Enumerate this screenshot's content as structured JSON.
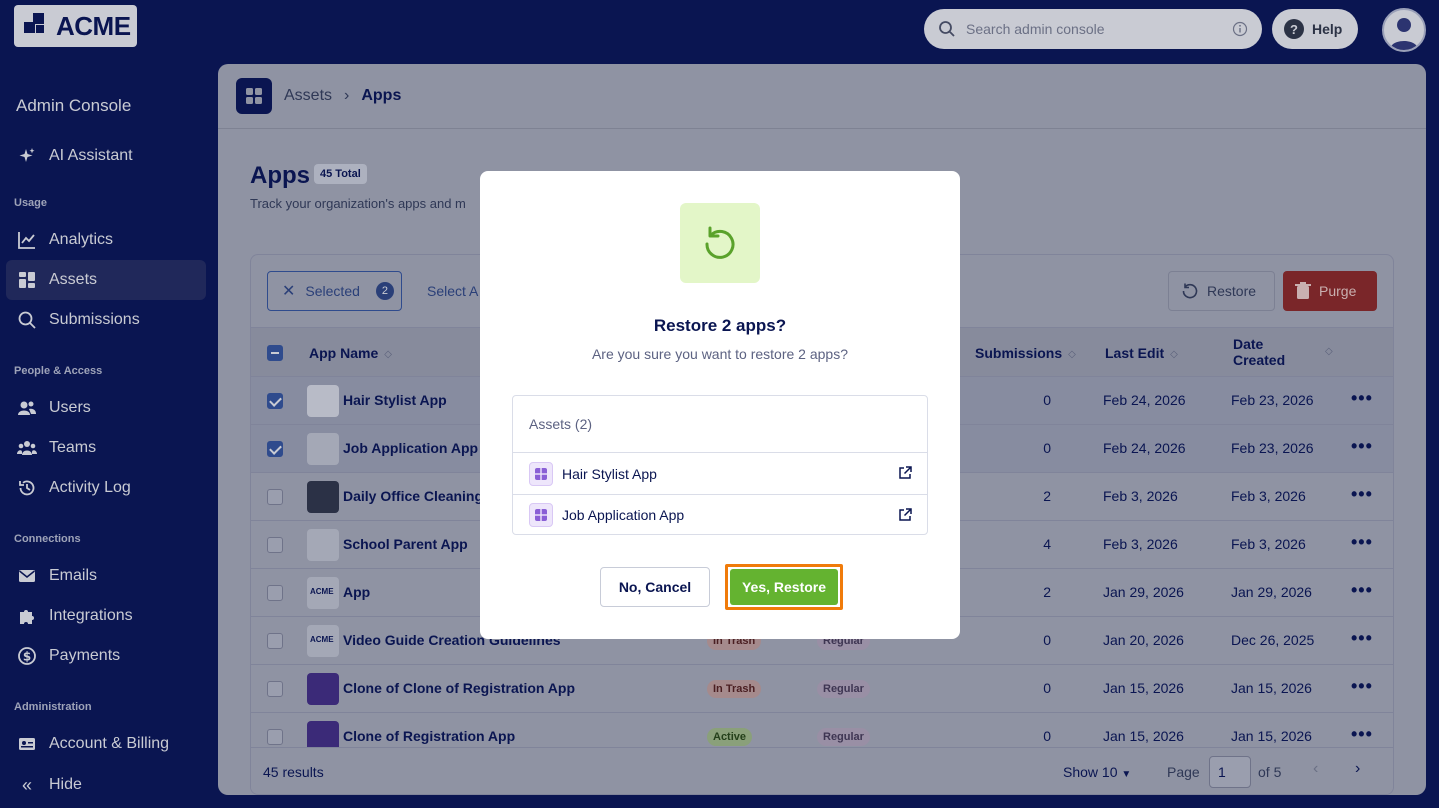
{
  "topbar": {
    "logo_text": "ACME",
    "search_placeholder": "Search admin console",
    "help_label": "Help"
  },
  "sidebar": {
    "title": "Admin Console",
    "ai_assistant": "AI Assistant",
    "sections": {
      "usage": "Usage",
      "people": "People & Access",
      "connections": "Connections",
      "administration": "Administration"
    },
    "items": {
      "analytics": "Analytics",
      "assets": "Assets",
      "submissions": "Submissions",
      "users": "Users",
      "teams": "Teams",
      "activity_log": "Activity Log",
      "emails": "Emails",
      "integrations": "Integrations",
      "payments": "Payments",
      "account_billing": "Account & Billing",
      "hide": "Hide"
    }
  },
  "breadcrumb": {
    "parent": "Assets",
    "separator": "›",
    "current": "Apps"
  },
  "page": {
    "title": "Apps",
    "total_badge": "45 Total",
    "subtitle": "Track your organization's apps and m"
  },
  "toolbar": {
    "selected_label": "Selected",
    "selected_count": "2",
    "select_all_label": "Select A",
    "restore_label": "Restore",
    "purge_label": "Purge"
  },
  "table": {
    "columns": {
      "app_name": "App Name",
      "submissions": "Submissions",
      "last_edit": "Last Edit",
      "date_created_1": "Date",
      "date_created_2": "Created"
    },
    "rows": [
      {
        "name": "Hair Stylist App",
        "status": "",
        "type": "",
        "submissions": "0",
        "last_edit": "Feb 24, 2026",
        "created": "Feb 23, 2026",
        "checked": true
      },
      {
        "name": "Job Application App",
        "status": "",
        "type": "",
        "submissions": "0",
        "last_edit": "Feb 24, 2026",
        "created": "Feb 23, 2026",
        "checked": true
      },
      {
        "name": "Daily Office Cleaning",
        "status": "",
        "type": "",
        "submissions": "2",
        "last_edit": "Feb 3, 2026",
        "created": "Feb 3, 2026",
        "checked": false
      },
      {
        "name": "School Parent App",
        "status": "",
        "type": "",
        "submissions": "4",
        "last_edit": "Feb 3, 2026",
        "created": "Feb 3, 2026",
        "checked": false
      },
      {
        "name": "App",
        "status": "",
        "type": "",
        "submissions": "2",
        "last_edit": "Jan 29, 2026",
        "created": "Jan 29, 2026",
        "checked": false
      },
      {
        "name": "Video Guide Creation Guidelines",
        "status": "In Trash",
        "type": "Regular",
        "submissions": "0",
        "last_edit": "Jan 20, 2026",
        "created": "Dec 26, 2025",
        "checked": false
      },
      {
        "name": "Clone of Clone of Registration App",
        "status": "In Trash",
        "type": "Regular",
        "submissions": "0",
        "last_edit": "Jan 15, 2026",
        "created": "Jan 15, 2026",
        "checked": false
      },
      {
        "name": "Clone of Registration App",
        "status": "Active",
        "type": "Regular",
        "submissions": "0",
        "last_edit": "Jan 15, 2026",
        "created": "Jan 15, 2026",
        "checked": false
      }
    ],
    "more_glyph": "•••",
    "thumb_logo_text": "ACME"
  },
  "footer": {
    "results": "45 results",
    "show_label": "Show 10",
    "page_label": "Page",
    "page_value": "1",
    "of_label": "of 5",
    "prev": "‹",
    "next": "›"
  },
  "modal": {
    "title": "Restore 2 apps?",
    "description": "Are you sure you want to restore 2 apps?",
    "assets_header": "Assets (2)",
    "assets": [
      "Hair Stylist App",
      "Job Application App"
    ],
    "cancel_label": "No, Cancel",
    "confirm_label": "Yes, Restore"
  },
  "colors": {
    "navy": "#0a1551",
    "confirm_green": "#64b330",
    "highlight_orange": "#f07b0a",
    "purge_red": "#c2302f",
    "icon_bg": "#e3f6c8"
  },
  "icons": [
    "search-icon",
    "info-icon",
    "help-icon",
    "restore-icon",
    "trash-icon",
    "external-link-icon",
    "app-grid-icon",
    "sparkle-icon"
  ]
}
